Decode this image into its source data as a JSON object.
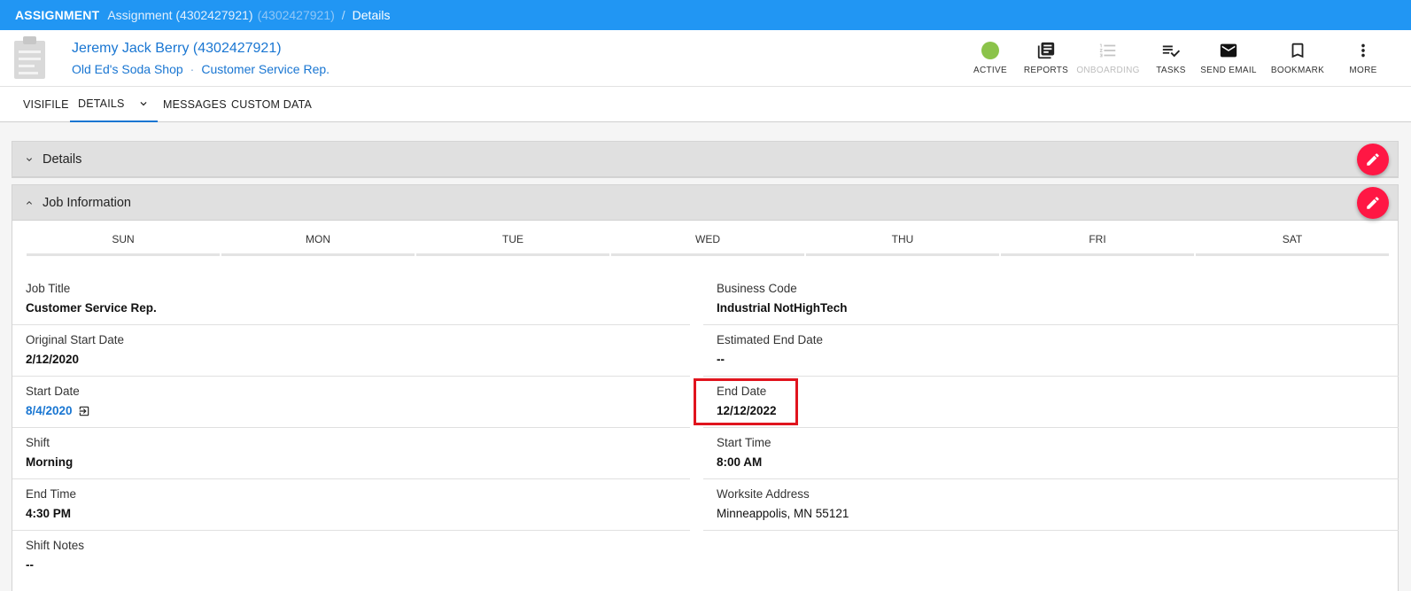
{
  "topbar": {
    "module": "ASSIGNMENT",
    "assignment": "Assignment (4302427921)",
    "assignment_id": "(4302427921)",
    "separator": "/",
    "current": "Details"
  },
  "header": {
    "name": "Jeremy Jack Berry (4302427921)",
    "company": "Old Ed's Soda Shop",
    "dot": "·",
    "role": "Customer Service Rep."
  },
  "actions": [
    {
      "label": "ACTIVE",
      "icon": "status-dot",
      "color": "#8bc34a"
    },
    {
      "label": "REPORTS",
      "icon": "reports-icon"
    },
    {
      "label": "ONBOARDING",
      "icon": "onboarding-icon",
      "disabled": true
    },
    {
      "label": "TASKS",
      "icon": "tasks-icon"
    },
    {
      "label": "SEND EMAIL",
      "icon": "email-icon"
    },
    {
      "label": "BOOKMARK",
      "icon": "bookmark-icon"
    },
    {
      "label": "MORE",
      "icon": "more-vert-icon"
    }
  ],
  "tabs": [
    {
      "label": "VISIFILE"
    },
    {
      "label": "DETAILS",
      "active": true
    },
    {
      "label": "MESSAGES"
    },
    {
      "label": "CUSTOM DATA"
    }
  ],
  "panels": {
    "details": {
      "title": "Details"
    },
    "job_info": {
      "title": "Job Information"
    }
  },
  "days": [
    "SUN",
    "MON",
    "TUE",
    "WED",
    "THU",
    "FRI",
    "SAT"
  ],
  "fields": {
    "job_title": {
      "label": "Job Title",
      "value": "Customer Service Rep."
    },
    "business_code": {
      "label": "Business Code",
      "value": "Industrial NotHighTech"
    },
    "original_start": {
      "label": "Original Start Date",
      "value": "2/12/2020"
    },
    "estimated_end": {
      "label": "Estimated End Date",
      "value": "--"
    },
    "start_date": {
      "label": "Start Date",
      "value": "8/4/2020"
    },
    "end_date": {
      "label": "End Date",
      "value": "12/12/2022"
    },
    "shift": {
      "label": "Shift",
      "value": "Morning"
    },
    "start_time": {
      "label": "Start Time",
      "value": "8:00 AM"
    },
    "end_time": {
      "label": "End Time",
      "value": "4:30 PM"
    },
    "worksite": {
      "label": "Worksite Address",
      "value": "Minneappolis, MN 55121"
    },
    "shift_notes": {
      "label": "Shift Notes",
      "value": "--"
    }
  },
  "colors": {
    "topbar": "#2196f3",
    "link": "#1976d2",
    "fab": "#ff1744",
    "highlight": "#e0141e"
  }
}
